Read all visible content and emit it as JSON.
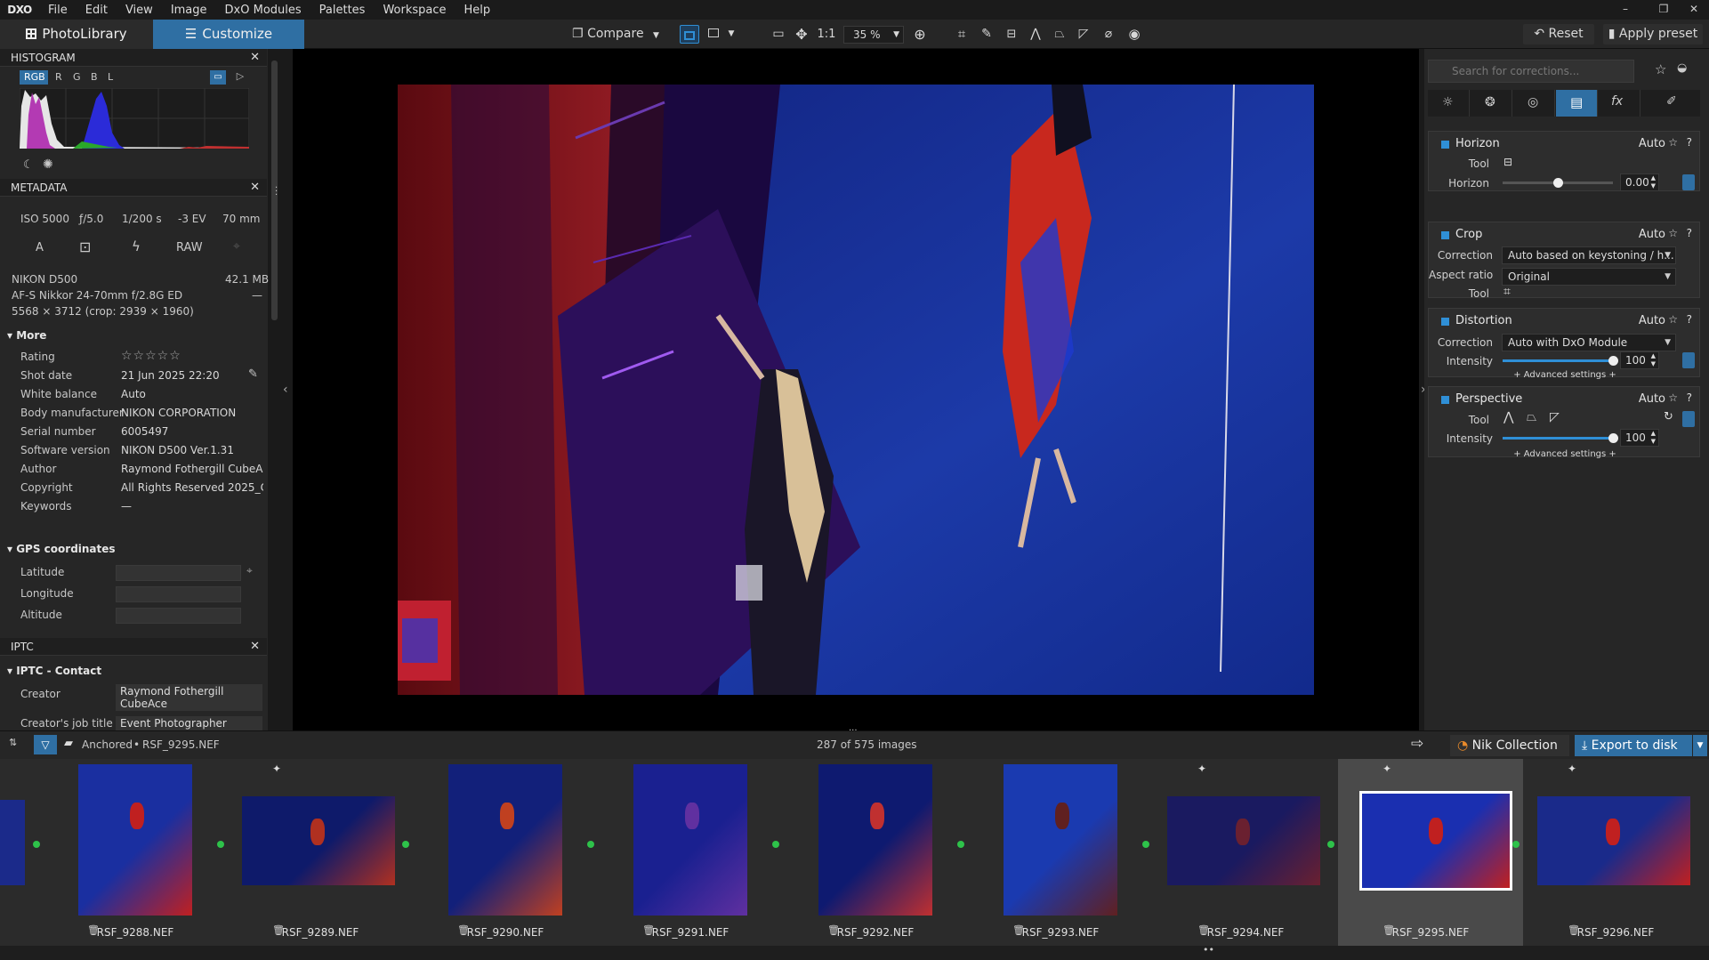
{
  "menubar": {
    "logo": "DXO",
    "items": [
      "File",
      "Edit",
      "View",
      "Image",
      "DxO Modules",
      "Palettes",
      "Workspace",
      "Help"
    ]
  },
  "toolbar": {
    "tab_photolibrary": "PhotoLibrary",
    "tab_customize": "Customize",
    "compare_label": "Compare",
    "one_to_one": "1:1",
    "zoom": "35 %",
    "reset_label": "Reset",
    "apply_preset_label": "Apply preset"
  },
  "histogram": {
    "title": "HISTOGRAM",
    "channels": [
      "RGB",
      "R",
      "G",
      "B",
      "L"
    ],
    "active_channel": "RGB"
  },
  "metadata": {
    "title": "METADATA",
    "iso": "ISO 5000",
    "aperture": "ƒ/5.0",
    "shutter": "1/200 s",
    "ev": "-3 EV",
    "focal": "70 mm",
    "mode": "A",
    "format": "RAW",
    "camera": "NIKON D500",
    "filesize": "42.1 MB",
    "lens": "AF-S Nikkor 24-70mm f/2.8G ED",
    "lens_extra": "—",
    "dimensions": "5568 × 3712  (crop: 2939 × 1960)",
    "more_title": "More",
    "fields": [
      {
        "label": "Rating",
        "value": "☆☆☆☆☆"
      },
      {
        "label": "Shot date",
        "value": "21 Jun 2025 22:20"
      },
      {
        "label": "White balance",
        "value": "Auto"
      },
      {
        "label": "Body manufacturer",
        "value": "NIKON CORPORATION"
      },
      {
        "label": "Serial number",
        "value": "6005497"
      },
      {
        "label": "Software version",
        "value": "NIKON D500 Ver.1.31"
      },
      {
        "label": "Author",
        "value": "Raymond Fothergill   CubeA..."
      },
      {
        "label": "Copyright",
        "value": "All Rights Reserved 2025_Co..."
      },
      {
        "label": "Keywords",
        "value": "—"
      }
    ],
    "gps_title": "GPS coordinates",
    "gps_fields": [
      "Latitude",
      "Longitude",
      "Altitude"
    ]
  },
  "iptc": {
    "title": "IPTC",
    "contact_title": "IPTC - Contact",
    "creator_label": "Creator",
    "creator_value_1": "Raymond Fothergill",
    "creator_value_2": "CubeAce",
    "job_label": "Creator's job title",
    "job_value": "Event Photographer"
  },
  "rightpanel": {
    "search_placeholder": "Search for corrections...",
    "horizon": {
      "title": "Horizon",
      "auto": "Auto",
      "tool_label": "Tool",
      "slider_label": "Horizon",
      "value": "0.00",
      "slider_fraction": 0.5
    },
    "crop": {
      "title": "Crop",
      "auto": "Auto",
      "correction_label": "Correction",
      "correction_value": "Auto based on keystoning / h...",
      "aspect_label": "Aspect ratio",
      "aspect_value": "Original",
      "tool_label": "Tool"
    },
    "distortion": {
      "title": "Distortion",
      "auto": "Auto",
      "correction_label": "Correction",
      "correction_value": "Auto with DxO Module",
      "intensity_label": "Intensity",
      "intensity_value": "100",
      "slider_fraction": 1.0,
      "advanced": "+ Advanced settings +"
    },
    "perspective": {
      "title": "Perspective",
      "auto": "Auto",
      "tool_label": "Tool",
      "intensity_label": "Intensity",
      "intensity_value": "100",
      "slider_fraction": 1.0,
      "advanced": "+ Advanced settings +"
    }
  },
  "filmbar": {
    "folder_label": "Anchored",
    "file_label": "RSF_9295.NEF",
    "count": "287 of 575 images",
    "nik_label": "Nik Collection",
    "export_label": "Export to disk"
  },
  "filmstrip": {
    "thumbs": [
      {
        "name": "RSF_9288.NEF",
        "selected": false
      },
      {
        "name": "RSF_9289.NEF",
        "selected": false
      },
      {
        "name": "RSF_9290.NEF",
        "selected": false
      },
      {
        "name": "RSF_9291.NEF",
        "selected": false
      },
      {
        "name": "RSF_9292.NEF",
        "selected": false
      },
      {
        "name": "RSF_9293.NEF",
        "selected": false
      },
      {
        "name": "RSF_9294.NEF",
        "selected": false
      },
      {
        "name": "RSF_9295.NEF",
        "selected": true
      },
      {
        "name": "RSF_9296.NEF",
        "selected": false
      }
    ]
  },
  "colors": {
    "accent": "#2f6fa3",
    "accent_light": "#2f8fd6",
    "panel_bg": "#262626",
    "viewer_bg": "#000000"
  }
}
